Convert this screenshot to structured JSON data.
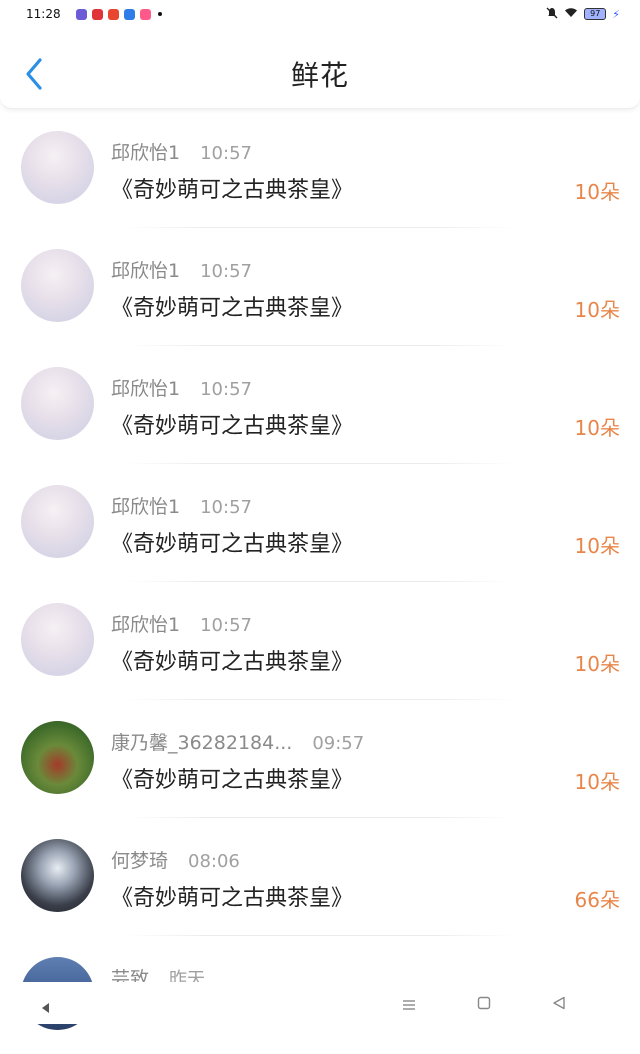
{
  "status_bar": {
    "time": "11:28",
    "battery": "97",
    "notif_colors": [
      "#6b5bd6",
      "#e0343b",
      "#e8462f",
      "#2f7be8",
      "#ff5a8a"
    ]
  },
  "header": {
    "title": "鲜花",
    "back_icon": "chevron-left-icon",
    "accent_color": "#2b8fe6"
  },
  "rows": [
    {
      "user": "邱欣怡1",
      "time": "10:57",
      "book": "《奇妙萌可之古典茶皇》",
      "count": "10朵",
      "avatar": "anime"
    },
    {
      "user": "邱欣怡1",
      "time": "10:57",
      "book": "《奇妙萌可之古典茶皇》",
      "count": "10朵",
      "avatar": "anime"
    },
    {
      "user": "邱欣怡1",
      "time": "10:57",
      "book": "《奇妙萌可之古典茶皇》",
      "count": "10朵",
      "avatar": "anime"
    },
    {
      "user": "邱欣怡1",
      "time": "10:57",
      "book": "《奇妙萌可之古典茶皇》",
      "count": "10朵",
      "avatar": "anime"
    },
    {
      "user": "邱欣怡1",
      "time": "10:57",
      "book": "《奇妙萌可之古典茶皇》",
      "count": "10朵",
      "avatar": "anime"
    },
    {
      "user": "康乃馨_36282184...",
      "time": "09:57",
      "book": "《奇妙萌可之古典茶皇》",
      "count": "10朵",
      "avatar": "apple"
    },
    {
      "user": "何梦琦",
      "time": "08:06",
      "book": "《奇妙萌可之古典茶皇》",
      "count": "66朵",
      "avatar": "dark"
    },
    {
      "user": "芸致",
      "time": "昨天",
      "book": "",
      "count": "",
      "avatar": "blue"
    }
  ],
  "nav_bar": {
    "icons": [
      "back-triangle-icon",
      "menu-icon",
      "home-square-icon",
      "back-outline-icon"
    ]
  },
  "colors": {
    "count": "#e8864a",
    "username": "#8a8a8a"
  }
}
